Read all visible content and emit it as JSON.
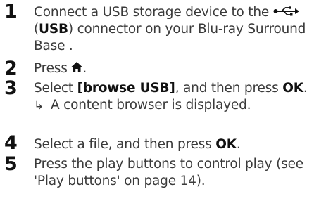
{
  "steps": [
    {
      "num": "1",
      "t1": "Connect a USB storage device to the ",
      "icon": "usb-symbol-icon",
      "t2": "(",
      "bold": "USB",
      "t3": ") connector on your Blu-ray Surround Base ."
    },
    {
      "num": "2",
      "t1": "Press ",
      "icon": "home-icon",
      "t2": "."
    },
    {
      "num": "3",
      "t1": "Select ",
      "bold1": "[browse USB]",
      "t2": ", and then press ",
      "bold2": "OK",
      "t3": ".",
      "result_arrow": "↳",
      "result_text": "A content browser is displayed."
    },
    {
      "num": "4",
      "t1": "Select a file, and then press ",
      "bold": "OK",
      "t2": "."
    },
    {
      "num": "5",
      "t1": "Press the play buttons to control play (see 'Play buttons' on page 14)."
    }
  ]
}
